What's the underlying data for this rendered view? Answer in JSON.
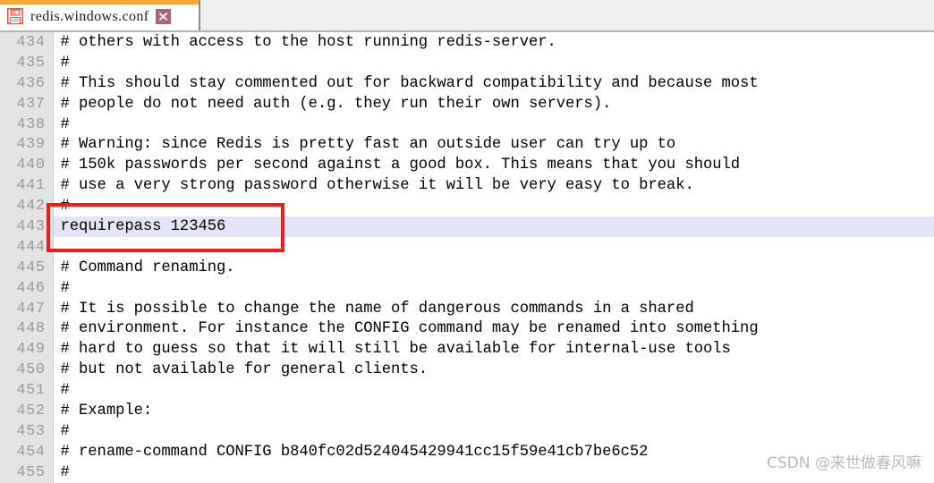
{
  "tab": {
    "title": "redis.windows.conf",
    "save_icon": "floppy-disk-icon",
    "close_icon": "close-icon",
    "accent_color": "#f7a83c",
    "close_bg_color": "#a8667f"
  },
  "editor": {
    "first_line_number": 434,
    "highlight_line_number": 443,
    "highlight_color": "#e4e4f7",
    "gutter_color": "#e4e4e4",
    "annotation_box_color": "#ee1c1c",
    "lines": [
      {
        "num": "434",
        "text": "# others with access to the host running redis-server."
      },
      {
        "num": "435",
        "text": "#"
      },
      {
        "num": "436",
        "text": "# This should stay commented out for backward compatibility and because most"
      },
      {
        "num": "437",
        "text": "# people do not need auth (e.g. they run their own servers)."
      },
      {
        "num": "438",
        "text": "#"
      },
      {
        "num": "439",
        "text": "# Warning: since Redis is pretty fast an outside user can try up to"
      },
      {
        "num": "440",
        "text": "# 150k passwords per second against a good box. This means that you should"
      },
      {
        "num": "441",
        "text": "# use a very strong password otherwise it will be very easy to break."
      },
      {
        "num": "442",
        "text": "#"
      },
      {
        "num": "443",
        "text": "requirepass 123456",
        "highlighted": true
      },
      {
        "num": "444",
        "text": ""
      },
      {
        "num": "445",
        "text": "# Command renaming."
      },
      {
        "num": "446",
        "text": "#"
      },
      {
        "num": "447",
        "text": "# It is possible to change the name of dangerous commands in a shared"
      },
      {
        "num": "448",
        "text": "# environment. For instance the CONFIG command may be renamed into something"
      },
      {
        "num": "449",
        "text": "# hard to guess so that it will still be available for internal-use tools"
      },
      {
        "num": "450",
        "text": "# but not available for general clients."
      },
      {
        "num": "451",
        "text": "#"
      },
      {
        "num": "452",
        "text": "# Example:"
      },
      {
        "num": "453",
        "text": "#"
      },
      {
        "num": "454",
        "text": "# rename-command CONFIG b840fc02d524045429941cc15f59e41cb7be6c52"
      },
      {
        "num": "455",
        "text": "#"
      }
    ]
  },
  "watermark": {
    "text": "CSDN @来世做春风嘛"
  }
}
